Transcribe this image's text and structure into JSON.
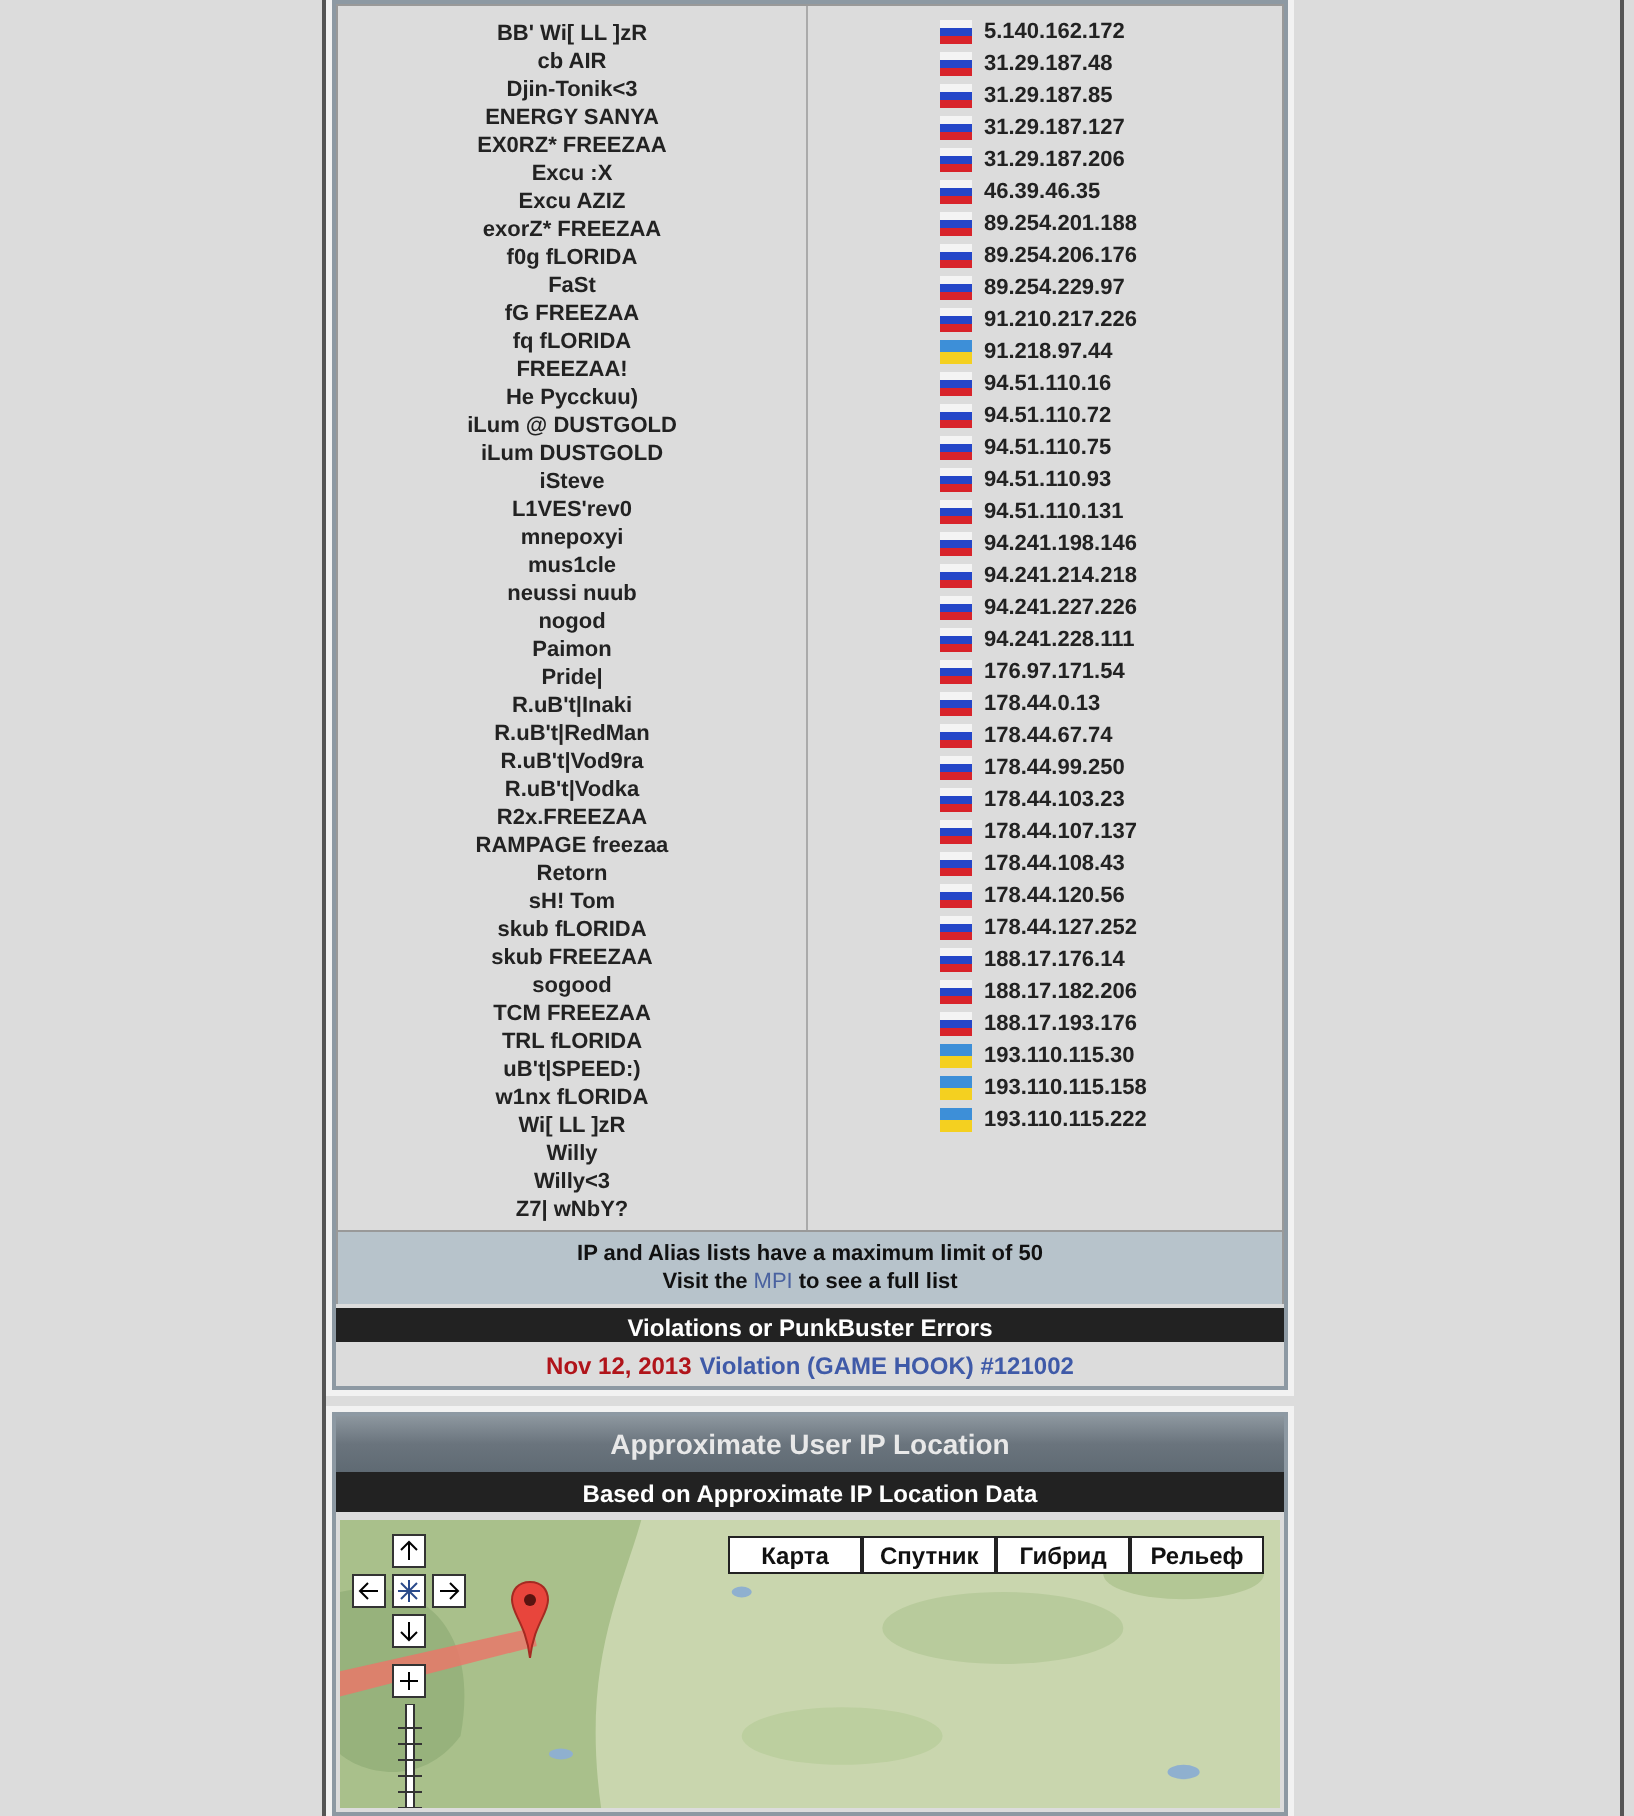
{
  "aliases": [
    "BB' Wi[ LL ]zR",
    "cb AIR",
    "Djin-Tonik<3",
    "ENERGY SANYA",
    "EX0RZ* FREEZAA",
    "Excu :X",
    "Excu AZIZ",
    "exorZ* FREEZAA",
    "f0g fLORIDA",
    "FaSt",
    "fG FREEZAA",
    "fq fLORIDA",
    "FREEZAA!",
    "He Pycckuu)",
    "iLum @ DUSTGOLD",
    "iLum DUSTGOLD",
    "iSteve",
    "L1VES'rev0",
    "mnepoxyi",
    "mus1cle",
    "neussi nuub",
    "nogod",
    "Paimon",
    "Pride|",
    "R.uB't|Inaki",
    "R.uB't|RedMan",
    "R.uB't|Vod9ra",
    "R.uB't|Vodka",
    "R2x.FREEZAA",
    "RAMPAGE freezaa",
    "Retorn",
    "sH! Tom",
    "skub fLORIDA",
    "skub FREEZAA",
    "sogood",
    "TCM FREEZAA",
    "TRL fLORIDA",
    "uB't|SPEED:)",
    "w1nx fLORIDA",
    "Wi[ LL ]zR",
    "Willy",
    "Willy<3",
    "Z7| wNbY?"
  ],
  "ips": [
    {
      "ip": "5.140.162.172",
      "kind": "ru"
    },
    {
      "ip": "31.29.187.48",
      "kind": "ru"
    },
    {
      "ip": "31.29.187.85",
      "kind": "ru"
    },
    {
      "ip": "31.29.187.127",
      "kind": "ru"
    },
    {
      "ip": "31.29.187.206",
      "kind": "ru"
    },
    {
      "ip": "46.39.46.35",
      "kind": "ru"
    },
    {
      "ip": "89.254.201.188",
      "kind": "ru"
    },
    {
      "ip": "89.254.206.176",
      "kind": "ru"
    },
    {
      "ip": "89.254.229.97",
      "kind": "ru"
    },
    {
      "ip": "91.210.217.226",
      "kind": "ru"
    },
    {
      "ip": "91.218.97.44",
      "kind": "ua"
    },
    {
      "ip": "94.51.110.16",
      "kind": "ru"
    },
    {
      "ip": "94.51.110.72",
      "kind": "ru"
    },
    {
      "ip": "94.51.110.75",
      "kind": "ru"
    },
    {
      "ip": "94.51.110.93",
      "kind": "ru"
    },
    {
      "ip": "94.51.110.131",
      "kind": "ru"
    },
    {
      "ip": "94.241.198.146",
      "kind": "ru"
    },
    {
      "ip": "94.241.214.218",
      "kind": "ru"
    },
    {
      "ip": "94.241.227.226",
      "kind": "ru"
    },
    {
      "ip": "94.241.228.111",
      "kind": "ru"
    },
    {
      "ip": "176.97.171.54",
      "kind": "ru"
    },
    {
      "ip": "178.44.0.13",
      "kind": "ru"
    },
    {
      "ip": "178.44.67.74",
      "kind": "ru"
    },
    {
      "ip": "178.44.99.250",
      "kind": "ru"
    },
    {
      "ip": "178.44.103.23",
      "kind": "ru"
    },
    {
      "ip": "178.44.107.137",
      "kind": "ru"
    },
    {
      "ip": "178.44.108.43",
      "kind": "ru"
    },
    {
      "ip": "178.44.120.56",
      "kind": "ru"
    },
    {
      "ip": "178.44.127.252",
      "kind": "ru"
    },
    {
      "ip": "188.17.176.14",
      "kind": "ru"
    },
    {
      "ip": "188.17.182.206",
      "kind": "ru"
    },
    {
      "ip": "188.17.193.176",
      "kind": "ru"
    },
    {
      "ip": "193.110.115.30",
      "kind": "ua"
    },
    {
      "ip": "193.110.115.158",
      "kind": "ua"
    },
    {
      "ip": "193.110.115.222",
      "kind": "ua"
    }
  ],
  "limit_note": {
    "line1": "IP and Alias lists have a maximum limit of 50",
    "before_link": "Visit the",
    "link": "MPI",
    "after_link": "to see a full list"
  },
  "violations": {
    "title": "Violations or PunkBuster Errors",
    "items": [
      {
        "date": "Nov 12, 2013",
        "text": "Violation (GAME HOOK) #121002"
      }
    ]
  },
  "location": {
    "title": "Approximate User IP Location",
    "subtitle": "Based on Approximate IP Location Data",
    "map_types": [
      "Карта",
      "Спутник",
      "Гибрид",
      "Рельеф"
    ]
  }
}
